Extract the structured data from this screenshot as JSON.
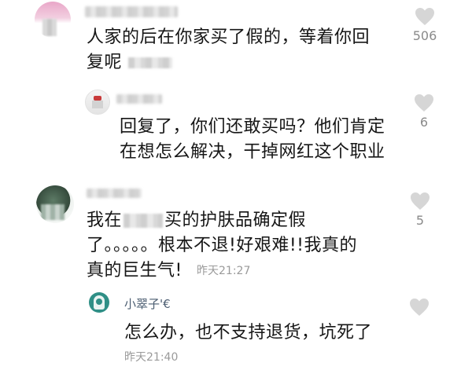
{
  "colors": {
    "text": "#161616",
    "muted": "#9a9a9a",
    "heart": "#d6d6d6",
    "count": "#8a8a8a"
  },
  "comments": [
    {
      "text_line1": "人家的后在你家买了假的，等着你回",
      "text_line2": "复呢",
      "likes": "506",
      "like_icon": "heart-outline-icon"
    },
    {
      "text_line1": "回复了，你们还敢买吗？他们肯定",
      "text_line2": "在想怎么解决，干掉网红这个职业",
      "likes": "6",
      "like_icon": "heart-outline-icon"
    },
    {
      "text_line1_a": "我在",
      "text_line1_b": "买的护肤品确定假",
      "text_line2": "了。。。。。根本不退!好艰难!!我真的",
      "text_line3": "真的巨生气!",
      "timestamp": "昨天21:27",
      "likes": "5",
      "like_icon": "heart-outline-icon"
    },
    {
      "username": "小翠子'€",
      "text": "怎么办，也不支持退货，坑死了",
      "timestamp": "昨天21:40",
      "like_icon": "heart-outline-icon"
    }
  ]
}
